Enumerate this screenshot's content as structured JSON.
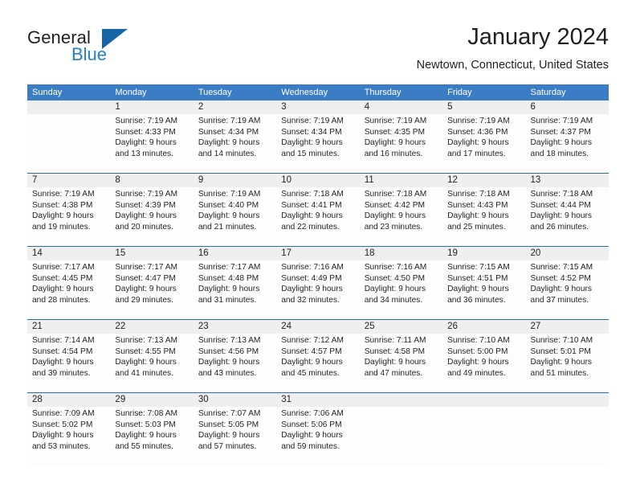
{
  "brand": {
    "name_dark": "General",
    "name_blue": "Blue",
    "accent_blue": "#1f7fd0",
    "triangle_blue": "#1565a8"
  },
  "header": {
    "title": "January 2024",
    "subtitle": "Newtown, Connecticut, United States"
  },
  "calendar": {
    "header_bg": "#3b7dc4",
    "row_divider": "#2e6da8",
    "date_band_bg": "#efefef",
    "weekdays": [
      "Sunday",
      "Monday",
      "Tuesday",
      "Wednesday",
      "Thursday",
      "Friday",
      "Saturday"
    ],
    "weeks": [
      [
        {
          "day": "",
          "sunrise": "",
          "sunset": "",
          "daylight1": "",
          "daylight2": "",
          "empty": true
        },
        {
          "day": "1",
          "sunrise": "Sunrise: 7:19 AM",
          "sunset": "Sunset: 4:33 PM",
          "daylight1": "Daylight: 9 hours",
          "daylight2": "and 13 minutes."
        },
        {
          "day": "2",
          "sunrise": "Sunrise: 7:19 AM",
          "sunset": "Sunset: 4:34 PM",
          "daylight1": "Daylight: 9 hours",
          "daylight2": "and 14 minutes."
        },
        {
          "day": "3",
          "sunrise": "Sunrise: 7:19 AM",
          "sunset": "Sunset: 4:34 PM",
          "daylight1": "Daylight: 9 hours",
          "daylight2": "and 15 minutes."
        },
        {
          "day": "4",
          "sunrise": "Sunrise: 7:19 AM",
          "sunset": "Sunset: 4:35 PM",
          "daylight1": "Daylight: 9 hours",
          "daylight2": "and 16 minutes."
        },
        {
          "day": "5",
          "sunrise": "Sunrise: 7:19 AM",
          "sunset": "Sunset: 4:36 PM",
          "daylight1": "Daylight: 9 hours",
          "daylight2": "and 17 minutes."
        },
        {
          "day": "6",
          "sunrise": "Sunrise: 7:19 AM",
          "sunset": "Sunset: 4:37 PM",
          "daylight1": "Daylight: 9 hours",
          "daylight2": "and 18 minutes."
        }
      ],
      [
        {
          "day": "7",
          "sunrise": "Sunrise: 7:19 AM",
          "sunset": "Sunset: 4:38 PM",
          "daylight1": "Daylight: 9 hours",
          "daylight2": "and 19 minutes."
        },
        {
          "day": "8",
          "sunrise": "Sunrise: 7:19 AM",
          "sunset": "Sunset: 4:39 PM",
          "daylight1": "Daylight: 9 hours",
          "daylight2": "and 20 minutes."
        },
        {
          "day": "9",
          "sunrise": "Sunrise: 7:19 AM",
          "sunset": "Sunset: 4:40 PM",
          "daylight1": "Daylight: 9 hours",
          "daylight2": "and 21 minutes."
        },
        {
          "day": "10",
          "sunrise": "Sunrise: 7:18 AM",
          "sunset": "Sunset: 4:41 PM",
          "daylight1": "Daylight: 9 hours",
          "daylight2": "and 22 minutes."
        },
        {
          "day": "11",
          "sunrise": "Sunrise: 7:18 AM",
          "sunset": "Sunset: 4:42 PM",
          "daylight1": "Daylight: 9 hours",
          "daylight2": "and 23 minutes."
        },
        {
          "day": "12",
          "sunrise": "Sunrise: 7:18 AM",
          "sunset": "Sunset: 4:43 PM",
          "daylight1": "Daylight: 9 hours",
          "daylight2": "and 25 minutes."
        },
        {
          "day": "13",
          "sunrise": "Sunrise: 7:18 AM",
          "sunset": "Sunset: 4:44 PM",
          "daylight1": "Daylight: 9 hours",
          "daylight2": "and 26 minutes."
        }
      ],
      [
        {
          "day": "14",
          "sunrise": "Sunrise: 7:17 AM",
          "sunset": "Sunset: 4:45 PM",
          "daylight1": "Daylight: 9 hours",
          "daylight2": "and 28 minutes."
        },
        {
          "day": "15",
          "sunrise": "Sunrise: 7:17 AM",
          "sunset": "Sunset: 4:47 PM",
          "daylight1": "Daylight: 9 hours",
          "daylight2": "and 29 minutes."
        },
        {
          "day": "16",
          "sunrise": "Sunrise: 7:17 AM",
          "sunset": "Sunset: 4:48 PM",
          "daylight1": "Daylight: 9 hours",
          "daylight2": "and 31 minutes."
        },
        {
          "day": "17",
          "sunrise": "Sunrise: 7:16 AM",
          "sunset": "Sunset: 4:49 PM",
          "daylight1": "Daylight: 9 hours",
          "daylight2": "and 32 minutes."
        },
        {
          "day": "18",
          "sunrise": "Sunrise: 7:16 AM",
          "sunset": "Sunset: 4:50 PM",
          "daylight1": "Daylight: 9 hours",
          "daylight2": "and 34 minutes."
        },
        {
          "day": "19",
          "sunrise": "Sunrise: 7:15 AM",
          "sunset": "Sunset: 4:51 PM",
          "daylight1": "Daylight: 9 hours",
          "daylight2": "and 36 minutes."
        },
        {
          "day": "20",
          "sunrise": "Sunrise: 7:15 AM",
          "sunset": "Sunset: 4:52 PM",
          "daylight1": "Daylight: 9 hours",
          "daylight2": "and 37 minutes."
        }
      ],
      [
        {
          "day": "21",
          "sunrise": "Sunrise: 7:14 AM",
          "sunset": "Sunset: 4:54 PM",
          "daylight1": "Daylight: 9 hours",
          "daylight2": "and 39 minutes."
        },
        {
          "day": "22",
          "sunrise": "Sunrise: 7:13 AM",
          "sunset": "Sunset: 4:55 PM",
          "daylight1": "Daylight: 9 hours",
          "daylight2": "and 41 minutes."
        },
        {
          "day": "23",
          "sunrise": "Sunrise: 7:13 AM",
          "sunset": "Sunset: 4:56 PM",
          "daylight1": "Daylight: 9 hours",
          "daylight2": "and 43 minutes."
        },
        {
          "day": "24",
          "sunrise": "Sunrise: 7:12 AM",
          "sunset": "Sunset: 4:57 PM",
          "daylight1": "Daylight: 9 hours",
          "daylight2": "and 45 minutes."
        },
        {
          "day": "25",
          "sunrise": "Sunrise: 7:11 AM",
          "sunset": "Sunset: 4:58 PM",
          "daylight1": "Daylight: 9 hours",
          "daylight2": "and 47 minutes."
        },
        {
          "day": "26",
          "sunrise": "Sunrise: 7:10 AM",
          "sunset": "Sunset: 5:00 PM",
          "daylight1": "Daylight: 9 hours",
          "daylight2": "and 49 minutes."
        },
        {
          "day": "27",
          "sunrise": "Sunrise: 7:10 AM",
          "sunset": "Sunset: 5:01 PM",
          "daylight1": "Daylight: 9 hours",
          "daylight2": "and 51 minutes."
        }
      ],
      [
        {
          "day": "28",
          "sunrise": "Sunrise: 7:09 AM",
          "sunset": "Sunset: 5:02 PM",
          "daylight1": "Daylight: 9 hours",
          "daylight2": "and 53 minutes."
        },
        {
          "day": "29",
          "sunrise": "Sunrise: 7:08 AM",
          "sunset": "Sunset: 5:03 PM",
          "daylight1": "Daylight: 9 hours",
          "daylight2": "and 55 minutes."
        },
        {
          "day": "30",
          "sunrise": "Sunrise: 7:07 AM",
          "sunset": "Sunset: 5:05 PM",
          "daylight1": "Daylight: 9 hours",
          "daylight2": "and 57 minutes."
        },
        {
          "day": "31",
          "sunrise": "Sunrise: 7:06 AM",
          "sunset": "Sunset: 5:06 PM",
          "daylight1": "Daylight: 9 hours",
          "daylight2": "and 59 minutes."
        },
        {
          "day": "",
          "sunrise": "",
          "sunset": "",
          "daylight1": "",
          "daylight2": "",
          "empty": true
        },
        {
          "day": "",
          "sunrise": "",
          "sunset": "",
          "daylight1": "",
          "daylight2": "",
          "empty": true
        },
        {
          "day": "",
          "sunrise": "",
          "sunset": "",
          "daylight1": "",
          "daylight2": "",
          "empty": true
        }
      ]
    ]
  }
}
